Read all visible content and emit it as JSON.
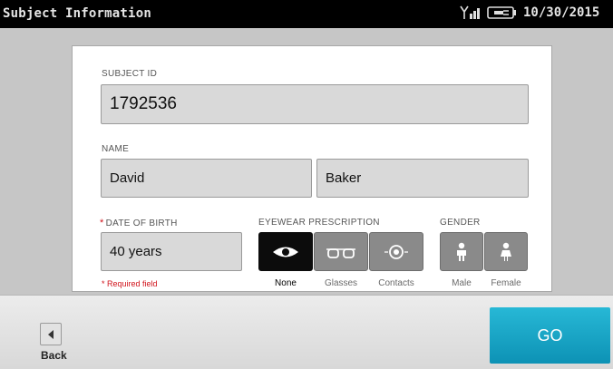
{
  "titlebar": {
    "title": "Subject Information",
    "date": "10/30/2015",
    "icons": [
      "antenna-signal-icon",
      "battery-plug-icon"
    ]
  },
  "form": {
    "subject_id": {
      "label": "SUBJECT ID",
      "value": "1792536"
    },
    "name": {
      "label": "NAME",
      "first": "David",
      "last": "Baker"
    },
    "dob": {
      "label": "DATE OF BIRTH",
      "required_marker": "*",
      "value": "40 years"
    },
    "required_note": "* Required field",
    "eyewear": {
      "label": "EYEWEAR PRESCRIPTION",
      "options": [
        "None",
        "Glasses",
        "Contacts"
      ],
      "selected": "None"
    },
    "gender": {
      "label": "GENDER",
      "options": [
        "Male",
        "Female"
      ],
      "selected": ""
    }
  },
  "footer": {
    "back_label": "Back",
    "go_label": "GO"
  },
  "colors": {
    "accent": "#1aa7c8",
    "required": "#d0121a",
    "titlebar_bg": "#000000"
  }
}
